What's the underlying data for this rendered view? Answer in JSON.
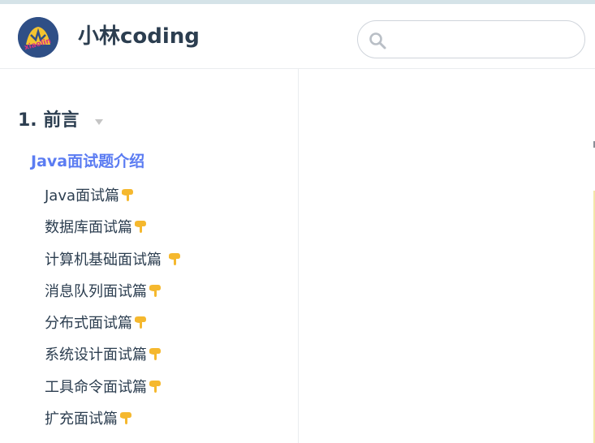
{
  "site": {
    "title": "小林coding",
    "logo_icon": "coding-logo-icon",
    "logo_text": "xiaolin"
  },
  "search": {
    "placeholder": "",
    "value": "",
    "icon": "search-icon"
  },
  "sidebar": {
    "group": {
      "title": "1. 前言",
      "expanded": true,
      "caret_icon": "caret-down-icon"
    },
    "active_item": "Java面试题介绍",
    "items": [
      {
        "label": "Java面试篇",
        "icon": "pointing-down-emoji"
      },
      {
        "label": "数据库面试篇",
        "icon": "pointing-down-emoji"
      },
      {
        "label": "计算机基础面试篇 ",
        "icon": "pointing-down-emoji"
      },
      {
        "label": "消息队列面试篇",
        "icon": "pointing-down-emoji"
      },
      {
        "label": "分布式面试篇",
        "icon": "pointing-down-emoji"
      },
      {
        "label": "系统设计面试篇",
        "icon": "pointing-down-emoji"
      },
      {
        "label": "工具命令面试篇",
        "icon": "pointing-down-emoji"
      },
      {
        "label": "扩充面试篇",
        "icon": "pointing-down-emoji"
      }
    ]
  },
  "colors": {
    "accent": "#5b7cf2",
    "text": "#2c3e50",
    "border": "#eaecef",
    "logo_bg": "#2f4f86",
    "emoji": "#f5b82e"
  }
}
